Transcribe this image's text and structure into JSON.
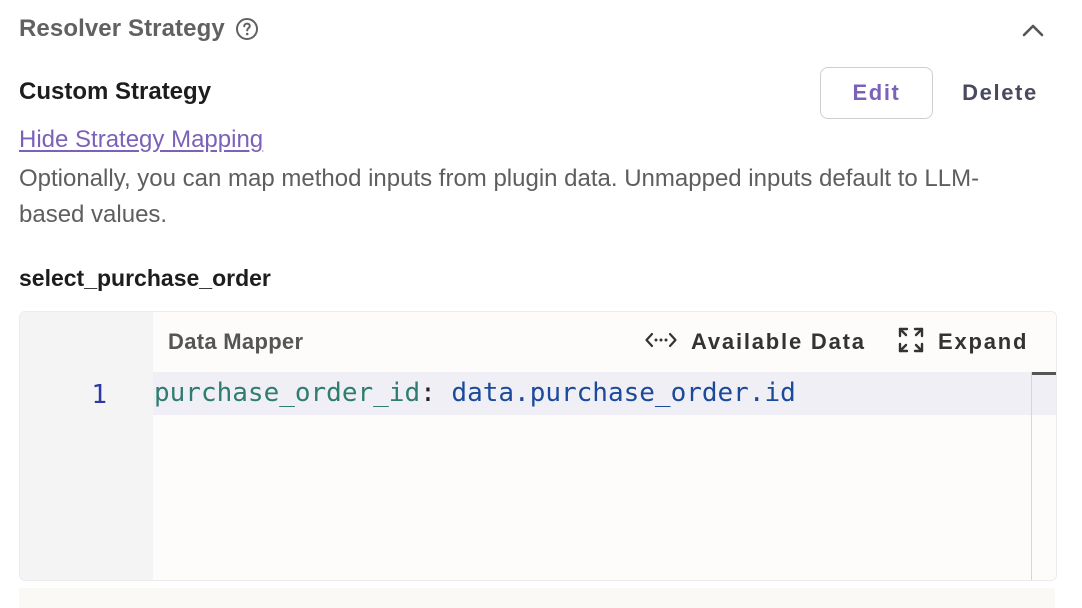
{
  "panel": {
    "title": "Resolver Strategy",
    "help_icon": "help-circle-icon",
    "collapse_icon": "chevron-up-icon"
  },
  "strategy": {
    "name": "Custom Strategy",
    "edit_label": "Edit",
    "delete_label": "Delete",
    "mapping_link": "Hide Strategy Mapping",
    "description": "Optionally, you can map method inputs from plugin data. Unmapped inputs default to LLM-based values."
  },
  "method": {
    "name": "select_purchase_order"
  },
  "editor": {
    "title": "Data Mapper",
    "available_data_label": "Available Data",
    "available_data_icon": "code-brackets-icon",
    "expand_label": "Expand",
    "expand_icon": "expand-icon",
    "lines": [
      {
        "number": "1",
        "key": "purchase_order_id",
        "separator": ": ",
        "value": "data.purchase_order.id"
      }
    ]
  },
  "colors": {
    "accent": "#7b62b8",
    "key_token": "#2e7d70",
    "value_token": "#1b4a9c",
    "line_number": "#2b3aa0"
  }
}
